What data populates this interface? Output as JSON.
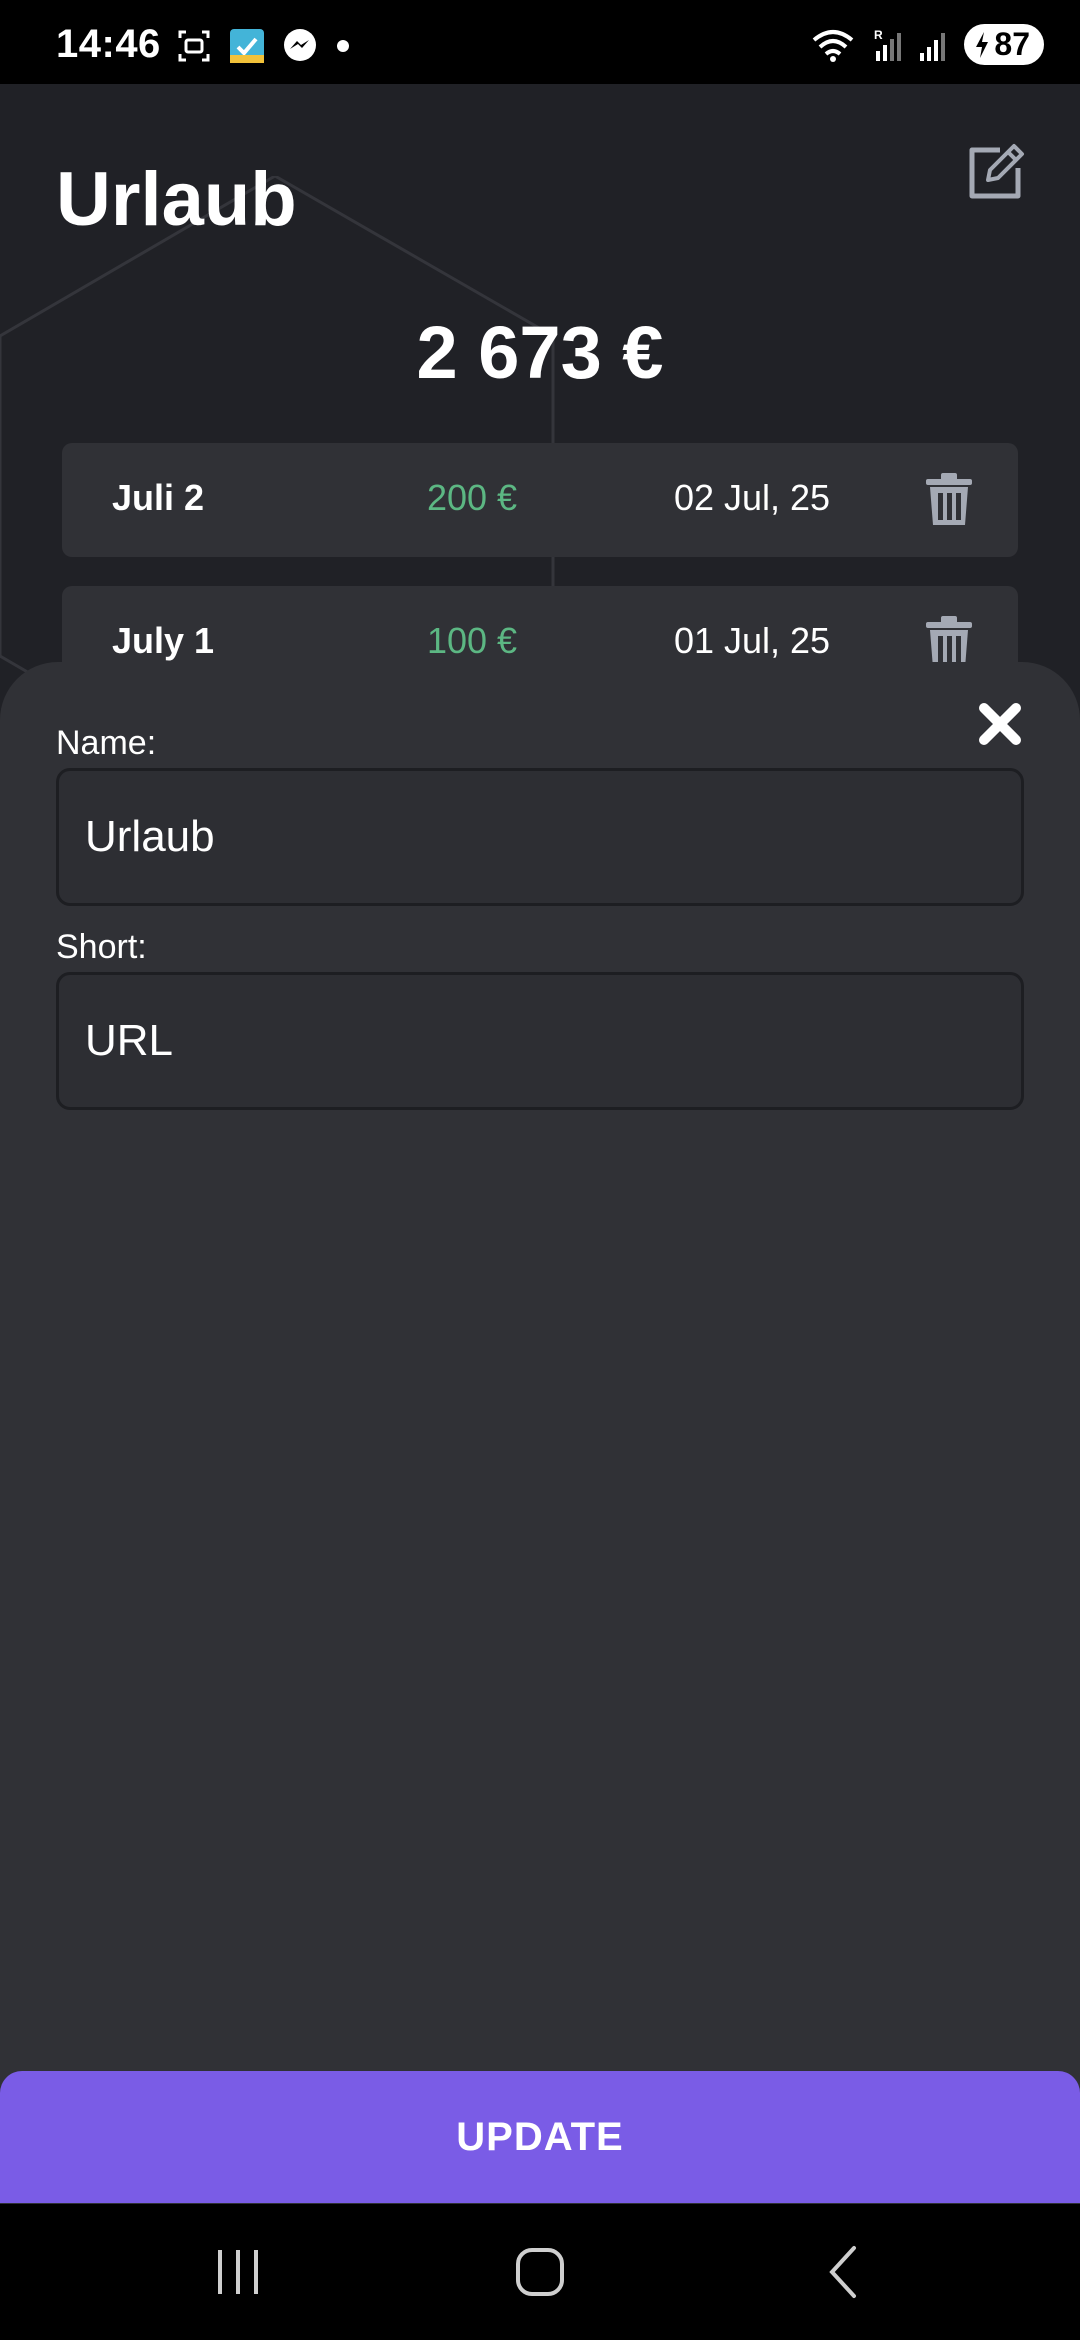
{
  "status_bar": {
    "time": "14:46",
    "battery": "87"
  },
  "header": {
    "title": "Urlaub",
    "total": "2 673 €"
  },
  "entries": [
    {
      "name": "Juli 2",
      "amount": "200 €",
      "date": "02 Jul, 25"
    },
    {
      "name": "July 1",
      "amount": "100 €",
      "date": "01 Jul, 25"
    }
  ],
  "sheet": {
    "name_label": "Name:",
    "name_value": "Urlaub",
    "short_label": "Short:",
    "short_value": "URL",
    "update_label": "UPDATE"
  },
  "colors": {
    "background": "#202126",
    "card": "#303136",
    "amount_positive": "#5cb783",
    "accent": "#7a5ce6"
  },
  "icons": {
    "edit": "edit-icon",
    "delete": "trash-icon",
    "close": "close-icon"
  }
}
